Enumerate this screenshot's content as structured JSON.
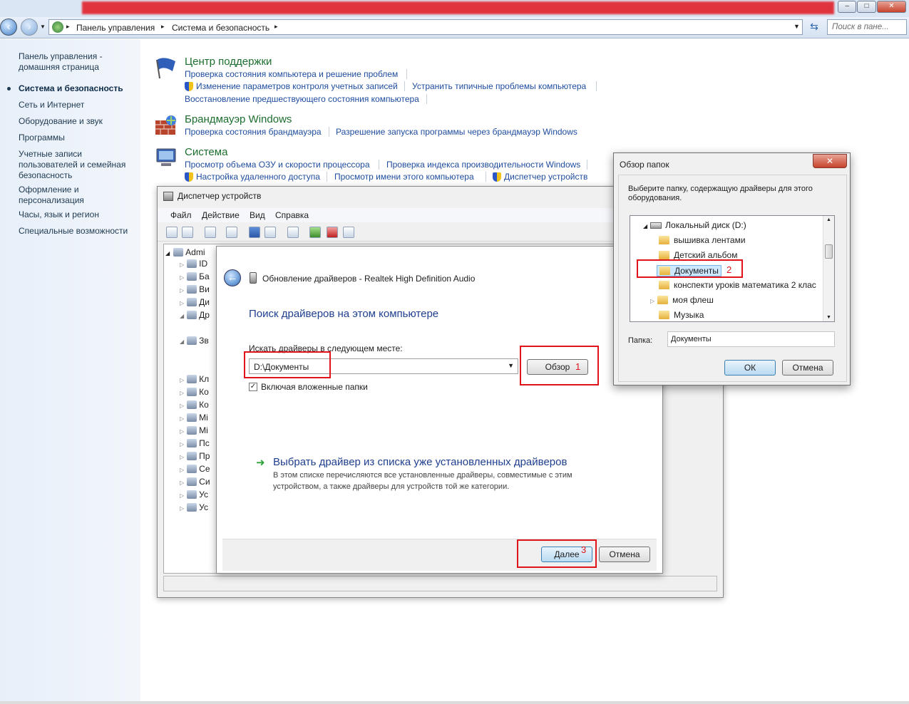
{
  "window_buttons": {
    "minimize": "–",
    "maximize": "□",
    "close": "✕"
  },
  "breadcrumb": [
    "Панель управления",
    "Система и безопасность"
  ],
  "search": {
    "placeholder": "Поиск в пане..."
  },
  "sidebar": {
    "home": "Панель управления - домашняя страница",
    "items": [
      "Система и безопасность",
      "Сеть и Интернет",
      "Оборудование и звук",
      "Программы",
      "Учетные записи пользователей и семейная безопасность",
      "Оформление и персонализация",
      "Часы, язык и регион",
      "Специальные возможности"
    ]
  },
  "sections": {
    "support": {
      "title": "Центр поддержки",
      "links": [
        "Проверка состояния компьютера и решение проблем",
        "Изменение параметров контроля учетных записей",
        "Устранить типичные проблемы компьютера",
        "Восстановление предшествующего состояния компьютера"
      ]
    },
    "firewall": {
      "title": "Брандмауэр Windows",
      "links": [
        "Проверка состояния брандмауэра",
        "Разрешение запуска программы через брандмауэр Windows"
      ]
    },
    "system": {
      "title": "Система",
      "links": [
        "Просмотр объема ОЗУ и скорости процессора",
        "Проверка индекса производительности Windows",
        "Настройка удаленного доступа",
        "Просмотр имени этого компьютера",
        "Диспетчер устройств"
      ]
    }
  },
  "device_manager": {
    "title": "Диспетчер устройств",
    "menu": [
      "Файл",
      "Действие",
      "Вид",
      "Справка"
    ],
    "tree_root": "Admi",
    "tree_stubs": [
      "ID",
      "Ба",
      "Ви",
      "Ди",
      "Др",
      "Зв",
      "Кл",
      "Ко",
      "Ко",
      "Мі",
      "Мі",
      "Пс",
      "Пр",
      "Се",
      "Си",
      "Ус",
      "Ус"
    ]
  },
  "driver_dialog": {
    "title": "Обновление драйверов - Realtek High Definition Audio",
    "heading": "Поиск драйверов на этом компьютере",
    "search_label": "Искать драйверы в следующем месте:",
    "path_value": "D:\\Документы",
    "browse_button": "Обзор",
    "include_subfolders": "Включая вложенные папки",
    "pick_title": "Выбрать драйвер из списка уже установленных драйверов",
    "pick_desc": "В этом списке перечисляются все установленные драйверы, совместимые с этим устройством, а также драйверы для устройств той же категории.",
    "next_button": "Далее",
    "cancel_button": "Отмена"
  },
  "browse_dialog": {
    "title": "Обзор папок",
    "close": "✕",
    "instruction": "Выберите папку, содержащую драйверы для этого оборудования.",
    "drive": "Локальный диск (D:)",
    "folders": [
      "вышивка лентами",
      "Детский альбом",
      "Документы",
      "конспекти уроків математика 2 клас",
      "моя флеш",
      "Музыка"
    ],
    "folder_label": "Папка:",
    "folder_value": "Документы",
    "ok_button": "ОК",
    "cancel_button": "Отмена"
  },
  "annotations": [
    "1",
    "2",
    "3"
  ]
}
